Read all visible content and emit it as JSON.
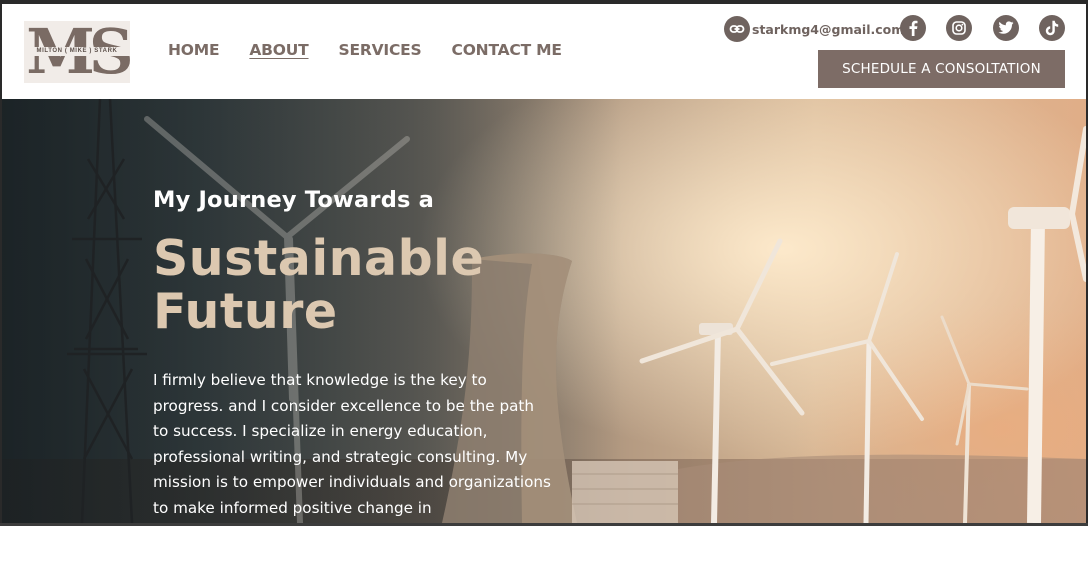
{
  "logo": {
    "letters": "MS",
    "name": "MILTON ( MIKE ) STARK"
  },
  "nav": {
    "items": [
      {
        "label": "HOME",
        "active": false
      },
      {
        "label": "ABOUT",
        "active": true
      },
      {
        "label": "SERVICES",
        "active": false
      },
      {
        "label": "CONTACT ME",
        "active": false
      }
    ]
  },
  "contact": {
    "email": "starkmg4@gmail.com",
    "icons": [
      "link-icon",
      "facebook-icon",
      "instagram-icon",
      "twitter-icon",
      "tiktok-icon"
    ]
  },
  "cta": {
    "label": "SCHEDULE A CONSOLTATION"
  },
  "hero": {
    "subtitle": "My Journey Towards a",
    "title": "Sustainable Future",
    "body": "I firmly believe that knowledge is the key to progress. and I consider excellence to be the path to success. I specialize in energy education, professional writing, and strategic consulting. My mission is to empower individuals and organizations to make informed positive change in"
  },
  "colors": {
    "brand": "#7d6c66",
    "icon": "#6f635f",
    "nav_text": "#7b6c66",
    "hero_title": "#dcc8b0"
  }
}
